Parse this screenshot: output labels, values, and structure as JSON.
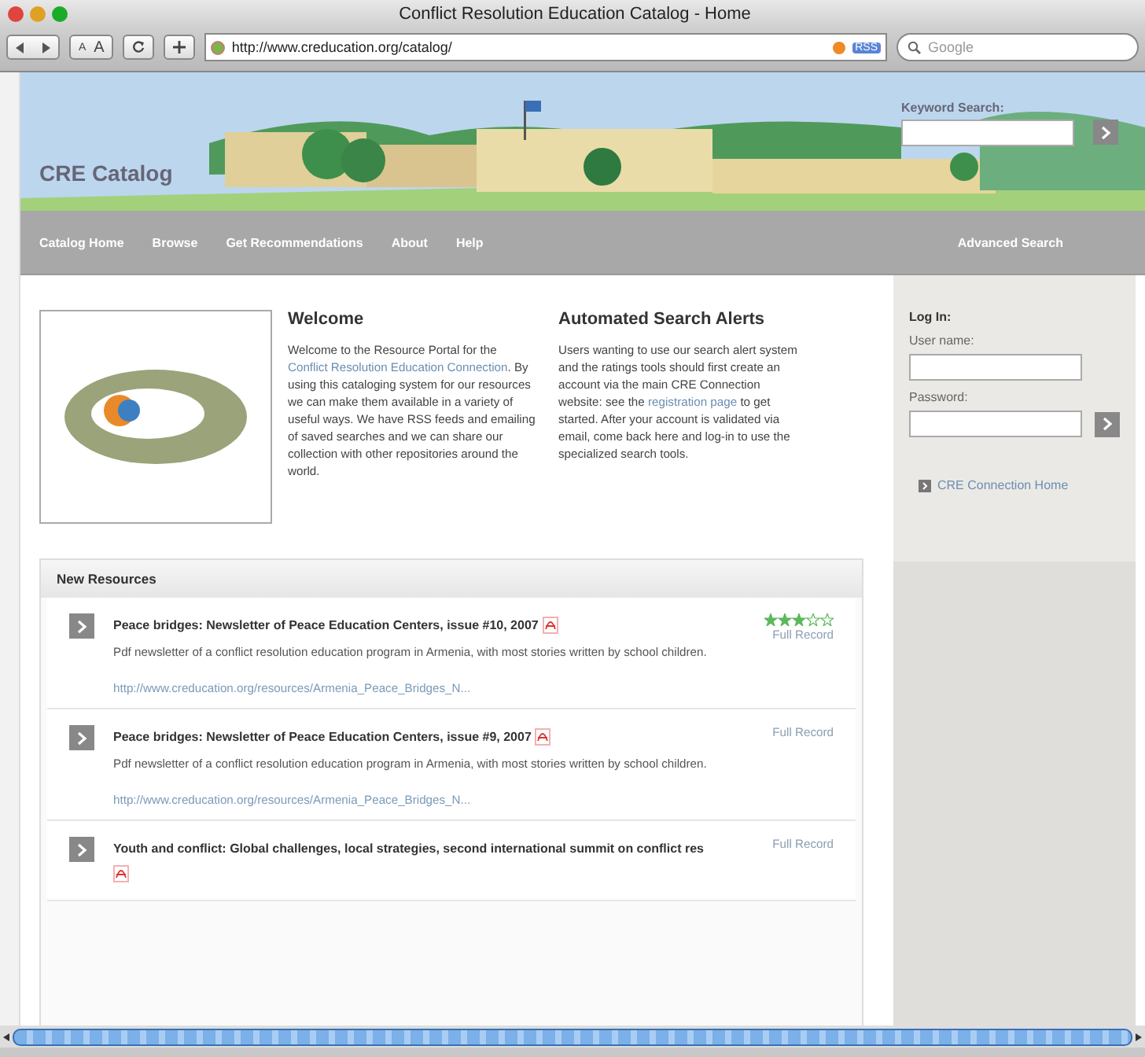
{
  "window": {
    "title": "Conflict Resolution Education Catalog - Home"
  },
  "toolbar": {
    "url": "http://www.creducation.org/catalog/",
    "rss": "RSS",
    "search_placeholder": "Google",
    "font_small": "A",
    "font_large": "A"
  },
  "banner": {
    "site_title": "CRE Catalog",
    "keyword_search_label": "Keyword Search:"
  },
  "nav": {
    "items": [
      "Catalog Home",
      "Browse",
      "Get Recommendations",
      "About",
      "Help"
    ],
    "advanced": "Advanced Search"
  },
  "welcome": {
    "title": "Welcome",
    "text": "Welcome to the Resource Portal for the ",
    "link": "Conflict Resolution Education Connection",
    "text_after": ". By using this cataloging system for our resources we can make them available in a variety of useful ways. We have RSS feeds and emailing of saved searches and we can share our collection with other repositories around the world."
  },
  "alerts": {
    "title": "Automated Search Alerts",
    "text": "Users wanting to use our search alert system and the ratings tools should first create an account via the main CRE Connection website: see the ",
    "link": "registration page",
    "text_after": " to get started. After your account is validated via email, come back here and log-in to use the specialized search tools."
  },
  "login": {
    "title": "Log In:",
    "username_label": "User name:",
    "password_label": "Password:",
    "home_link": "CRE Connection Home"
  },
  "new_resources": {
    "title": "New Resources",
    "items": [
      {
        "title": "Peace bridges: Newsletter of Peace Education Centers, issue #10, 2007",
        "description": "Pdf newsletter of a conflict resolution education program in Armenia, with most stories written by school children.",
        "url": "http://www.creducation.org/resources/Armenia_Peace_Bridges_N...",
        "full_record": "Full Record",
        "stars": 3
      },
      {
        "title": "Peace bridges: Newsletter of Peace Education Centers, issue #9, 2007",
        "description": "Pdf newsletter of a conflict resolution education program in Armenia, with most stories written by school children.",
        "url": "http://www.creducation.org/resources/Armenia_Peace_Bridges_N...",
        "full_record": "Full Record"
      },
      {
        "title": "Youth and conflict: Global challenges, local strategies, second international summit on conflict res",
        "full_record": "Full Record"
      }
    ]
  }
}
